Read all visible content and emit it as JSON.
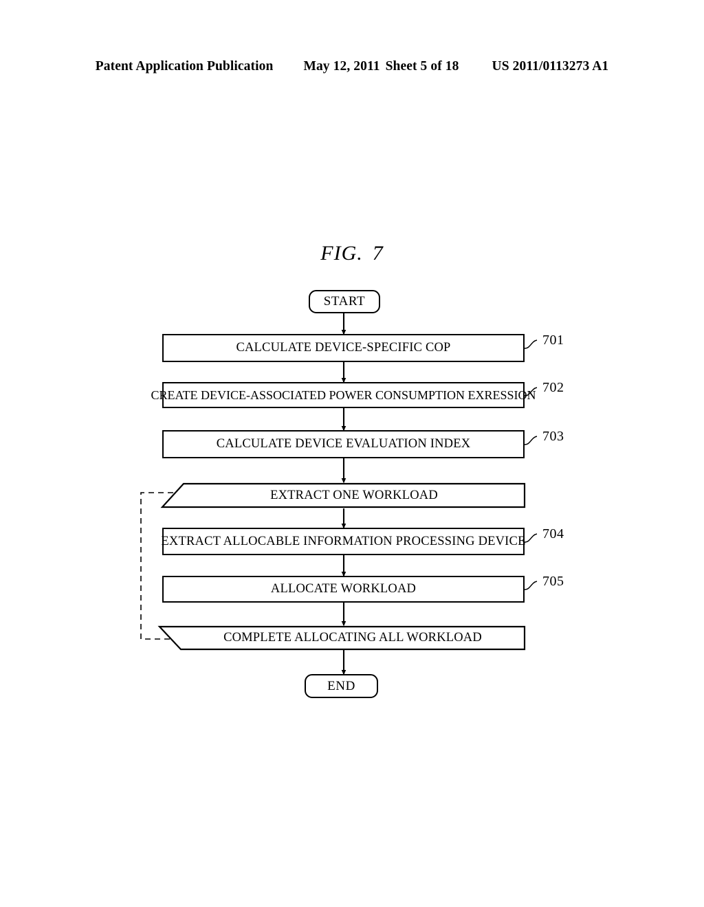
{
  "header": {
    "publication": "Patent Application Publication",
    "date": "May 12, 2011",
    "sheet": "Sheet 5 of 18",
    "patent_number": "US 2011/0113273 A1"
  },
  "figure": {
    "label": "FIG.",
    "number": "7"
  },
  "flowchart": {
    "start_label": "START",
    "end_label": "END",
    "steps": [
      {
        "id": "701",
        "label": "CALCULATE DEVICE-SPECIFIC COP",
        "shape": "process"
      },
      {
        "id": "702",
        "label": "CREATE DEVICE-ASSOCIATED POWER CONSUMPTION EXRESSION",
        "shape": "process"
      },
      {
        "id": "703",
        "label": "CALCULATE DEVICE EVALUATION INDEX",
        "shape": "process"
      },
      {
        "id": "",
        "label": "EXTRACT ONE WORKLOAD",
        "shape": "loop-start"
      },
      {
        "id": "704",
        "label": "EXTRACT ALLOCABLE INFORMATION PROCESSING DEVICE",
        "shape": "process"
      },
      {
        "id": "705",
        "label": "ALLOCATE WORKLOAD",
        "shape": "process"
      },
      {
        "id": "",
        "label": "COMPLETE ALLOCATING ALL WORKLOAD",
        "shape": "loop-end"
      }
    ],
    "refnums": [
      "701",
      "702",
      "703",
      "704",
      "705"
    ],
    "loopback": "dashed-loop-return"
  },
  "colors": {
    "ink": "#000000",
    "paper": "#ffffff"
  }
}
